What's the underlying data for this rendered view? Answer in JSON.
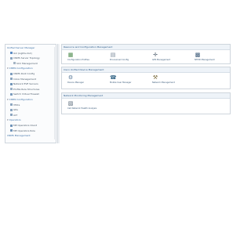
{
  "sidebar": {
    "items": [
      {
        "label": "Unified Server Manager",
        "indent": 0,
        "section": true,
        "toggle": "",
        "icon_color": ""
      },
      {
        "label": "ILO (Lights-Out)",
        "indent": 1,
        "section": false,
        "toggle": "",
        "icon_color": "#5b8bc4"
      },
      {
        "label": "CNMS Server Topology",
        "indent": 1,
        "section": false,
        "toggle": "",
        "icon_color": "#8aa4bf"
      },
      {
        "label": "SCC Management",
        "indent": 2,
        "section": false,
        "toggle": "",
        "icon_color": "#a3b3c3"
      },
      {
        "label": "CNMS Configuration",
        "indent": 0,
        "section": true,
        "toggle": "▾",
        "icon_color": ""
      },
      {
        "label": "CNMS Root Config",
        "indent": 1,
        "section": false,
        "toggle": "",
        "icon_color": "#7a9bbd"
      },
      {
        "label": "Inbox Management",
        "indent": 1,
        "section": false,
        "toggle": "",
        "icon_color": "#8aa4bf"
      },
      {
        "label": "Network EVE Servers",
        "indent": 1,
        "section": false,
        "toggle": "",
        "icon_color": "#6f93b8"
      },
      {
        "label": "Profile Rule Structures",
        "indent": 1,
        "section": false,
        "toggle": "",
        "icon_color": "#9ab0c6"
      },
      {
        "label": "Switch Virtual Firewall",
        "indent": 1,
        "section": false,
        "toggle": "",
        "icon_color": "#7a9bbd"
      },
      {
        "label": "CNMS Configuration",
        "indent": 0,
        "section": true,
        "toggle": "▾",
        "icon_color": ""
      },
      {
        "label": "VMCs",
        "indent": 1,
        "section": false,
        "toggle": "",
        "icon_color": "#8aa4bf"
      },
      {
        "label": "GRs",
        "indent": 1,
        "section": false,
        "toggle": "",
        "icon_color": "#8aa4bf"
      },
      {
        "label": "ALT",
        "indent": 1,
        "section": false,
        "toggle": "",
        "icon_color": "#8aa4bf"
      },
      {
        "label": "Operators",
        "indent": 0,
        "section": true,
        "toggle": "▾",
        "icon_color": ""
      },
      {
        "label": "ME Operators Client",
        "indent": 1,
        "section": false,
        "toggle": "",
        "icon_color": "#6f93b8"
      },
      {
        "label": "ME Operators Role",
        "indent": 1,
        "section": false,
        "toggle": "",
        "icon_color": "#6f93b8"
      },
      {
        "label": "CNMS Management",
        "indent": 0,
        "section": true,
        "toggle": "",
        "icon_color": ""
      }
    ]
  },
  "groups": [
    {
      "title": "Resource and Configuration Management",
      "tiles": [
        {
          "label": "Configuration Profiles",
          "icon_name": "config-profiles-icon",
          "glyph": "▦",
          "color": "#4a8a4a"
        },
        {
          "label": "Provisioned Config",
          "icon_name": "provisioned-config-icon",
          "glyph": "▤",
          "color": "#7a8a9a"
        },
        {
          "label": "GPS Management",
          "icon_name": "gps-management-icon",
          "glyph": "✛",
          "color": "#506070"
        },
        {
          "label": "NTMD Management",
          "icon_name": "ntmd-management-icon",
          "glyph": "▩",
          "color": "#3c5a78"
        }
      ]
    },
    {
      "title": "Cisco Unified Device Management",
      "tiles": [
        {
          "label": "Device Manager",
          "icon_name": "device-manager-icon",
          "glyph": "⚙",
          "color": "#5a7a9a"
        },
        {
          "label": "Mobile User Manager",
          "icon_name": "mobile-user-manager-icon",
          "glyph": "☎",
          "color": "#3a6a8a"
        },
        {
          "label": "Network Management",
          "icon_name": "network-management-icon",
          "glyph": "⚒",
          "color": "#7a6a3a"
        }
      ]
    },
    {
      "title": "Network Monitoring Management",
      "tiles": [
        {
          "label": "Call Network Health Analysis",
          "icon_name": "network-health-icon",
          "glyph": "▧",
          "color": "#5a6a7a"
        }
      ]
    }
  ]
}
